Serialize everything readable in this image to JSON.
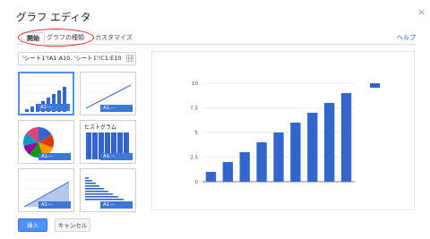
{
  "dialog": {
    "title": "グラフ エディタ",
    "close_symbol": "×"
  },
  "tabs": [
    {
      "label": "開始",
      "active": true
    },
    {
      "label": "グラフの種類",
      "active": false
    },
    {
      "label": "カスタマイズ",
      "active": false
    }
  ],
  "help_link": "ヘルプ",
  "data_range": {
    "value": "'シート1'!A1:A10, 'シート1'!C1:E10"
  },
  "thumbnails": [
    {
      "type": "column",
      "badge": "A1---",
      "selected": true
    },
    {
      "type": "line",
      "badge": "A1---"
    },
    {
      "type": "pie",
      "badge": "A1---"
    },
    {
      "type": "histogram",
      "label": "ヒストグラム",
      "badge": "A1---"
    },
    {
      "type": "area",
      "badge": "A1---"
    },
    {
      "type": "bar",
      "badge": "A1---"
    }
  ],
  "buttons": {
    "insert": "挿入",
    "cancel": "キャンセル"
  },
  "colors": {
    "accent": "#4d90fe",
    "bar": "#3366cc",
    "annotation_circle": "#e02020",
    "link": "#1155cc"
  },
  "chart_data": {
    "type": "bar",
    "categories": [
      "1",
      "2",
      "3",
      "4",
      "5",
      "6",
      "7",
      "8",
      "9"
    ],
    "values": [
      1,
      2,
      3,
      4,
      5,
      6,
      7,
      8,
      9
    ],
    "yticks": [
      "0",
      "2.5",
      "5",
      "7.5",
      "10"
    ],
    "ylim": [
      0,
      10
    ],
    "legend": "top-right",
    "grid": true
  }
}
